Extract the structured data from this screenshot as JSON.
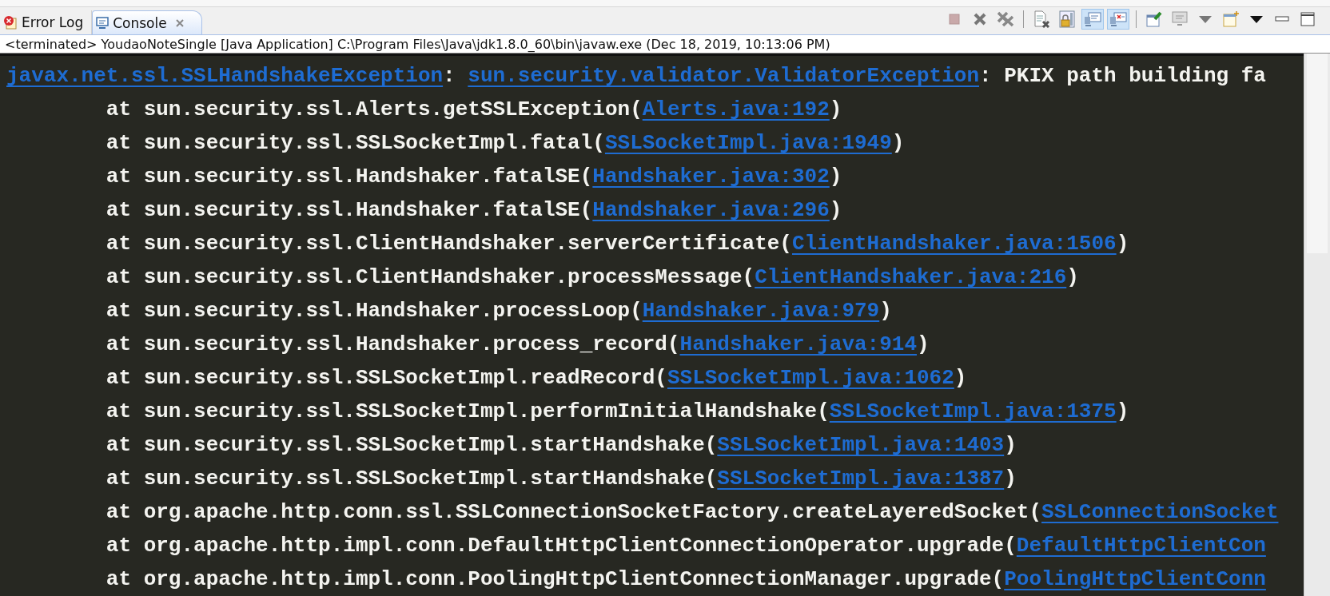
{
  "tabs": [
    {
      "label": "Error Log",
      "kind": "error",
      "selected": false,
      "closable": false
    },
    {
      "label": "Console",
      "kind": "console",
      "selected": true,
      "closable": true
    }
  ],
  "toolbar": [
    {
      "kind": "terminate",
      "on": false
    },
    {
      "kind": "remove",
      "on": false
    },
    {
      "kind": "remove_all",
      "on": false
    },
    {
      "kind": "clear",
      "on": false
    },
    {
      "kind": "scroll_lock",
      "on": false
    },
    {
      "kind": "stdout",
      "on": true
    },
    {
      "kind": "stderr",
      "on": true
    },
    {
      "kind": "pin",
      "on": false
    },
    {
      "kind": "display",
      "on": false
    },
    {
      "kind": "caret_gray",
      "on": false
    },
    {
      "kind": "open_console",
      "on": false
    },
    {
      "kind": "caret",
      "on": false
    },
    {
      "kind": "minimize",
      "on": false
    },
    {
      "kind": "maximize",
      "on": false
    }
  ],
  "process_label": "<terminated> YoudaoNoteSingle [Java Application] C:\\Program Files\\Java\\jdk1.8.0_60\\bin\\javaw.exe (Dec 18, 2019, 10:13:06 PM)",
  "console_lines": [
    {
      "segments": [
        {
          "kind": "link",
          "text": "javax.net.ssl.SSLHandshakeException"
        },
        {
          "kind": "text",
          "text": ": "
        },
        {
          "kind": "link",
          "text": "sun.security.validator.ValidatorException"
        },
        {
          "kind": "text",
          "text": ": PKIX path building fa"
        }
      ]
    },
    {
      "segments": [
        {
          "kind": "text",
          "text": "\tat sun.security.ssl.Alerts.getSSLException("
        },
        {
          "kind": "link",
          "text": "Alerts.java:192"
        },
        {
          "kind": "text",
          "text": ")"
        }
      ]
    },
    {
      "segments": [
        {
          "kind": "text",
          "text": "\tat sun.security.ssl.SSLSocketImpl.fatal("
        },
        {
          "kind": "link",
          "text": "SSLSocketImpl.java:1949"
        },
        {
          "kind": "text",
          "text": ")"
        }
      ]
    },
    {
      "segments": [
        {
          "kind": "text",
          "text": "\tat sun.security.ssl.Handshaker.fatalSE("
        },
        {
          "kind": "link",
          "text": "Handshaker.java:302"
        },
        {
          "kind": "text",
          "text": ")"
        }
      ]
    },
    {
      "segments": [
        {
          "kind": "text",
          "text": "\tat sun.security.ssl.Handshaker.fatalSE("
        },
        {
          "kind": "link",
          "text": "Handshaker.java:296"
        },
        {
          "kind": "text",
          "text": ")"
        }
      ]
    },
    {
      "segments": [
        {
          "kind": "text",
          "text": "\tat sun.security.ssl.ClientHandshaker.serverCertificate("
        },
        {
          "kind": "link",
          "text": "ClientHandshaker.java:1506"
        },
        {
          "kind": "text",
          "text": ")"
        }
      ]
    },
    {
      "segments": [
        {
          "kind": "text",
          "text": "\tat sun.security.ssl.ClientHandshaker.processMessage("
        },
        {
          "kind": "link",
          "text": "ClientHandshaker.java:216"
        },
        {
          "kind": "text",
          "text": ")"
        }
      ]
    },
    {
      "segments": [
        {
          "kind": "text",
          "text": "\tat sun.security.ssl.Handshaker.processLoop("
        },
        {
          "kind": "link",
          "text": "Handshaker.java:979"
        },
        {
          "kind": "text",
          "text": ")"
        }
      ]
    },
    {
      "segments": [
        {
          "kind": "text",
          "text": "\tat sun.security.ssl.Handshaker.process_record("
        },
        {
          "kind": "link",
          "text": "Handshaker.java:914"
        },
        {
          "kind": "text",
          "text": ")"
        }
      ]
    },
    {
      "segments": [
        {
          "kind": "text",
          "text": "\tat sun.security.ssl.SSLSocketImpl.readRecord("
        },
        {
          "kind": "link",
          "text": "SSLSocketImpl.java:1062"
        },
        {
          "kind": "text",
          "text": ")"
        }
      ]
    },
    {
      "segments": [
        {
          "kind": "text",
          "text": "\tat sun.security.ssl.SSLSocketImpl.performInitialHandshake("
        },
        {
          "kind": "link",
          "text": "SSLSocketImpl.java:1375"
        },
        {
          "kind": "text",
          "text": ")"
        }
      ]
    },
    {
      "segments": [
        {
          "kind": "text",
          "text": "\tat sun.security.ssl.SSLSocketImpl.startHandshake("
        },
        {
          "kind": "link",
          "text": "SSLSocketImpl.java:1403"
        },
        {
          "kind": "text",
          "text": ")"
        }
      ]
    },
    {
      "segments": [
        {
          "kind": "text",
          "text": "\tat sun.security.ssl.SSLSocketImpl.startHandshake("
        },
        {
          "kind": "link",
          "text": "SSLSocketImpl.java:1387"
        },
        {
          "kind": "text",
          "text": ")"
        }
      ]
    },
    {
      "segments": [
        {
          "kind": "text",
          "text": "\tat org.apache.http.conn.ssl.SSLConnectionSocketFactory.createLayeredSocket("
        },
        {
          "kind": "link",
          "text": "SSLConnectionSocket"
        }
      ]
    },
    {
      "segments": [
        {
          "kind": "text",
          "text": "\tat org.apache.http.impl.conn.DefaultHttpClientConnectionOperator.upgrade("
        },
        {
          "kind": "link",
          "text": "DefaultHttpClientCon"
        }
      ]
    },
    {
      "segments": [
        {
          "kind": "text",
          "text": "\tat org.apache.http.impl.conn.PoolingHttpClientConnectionManager.upgrade("
        },
        {
          "kind": "link",
          "text": "PoolingHttpClientConn"
        }
      ]
    }
  ]
}
